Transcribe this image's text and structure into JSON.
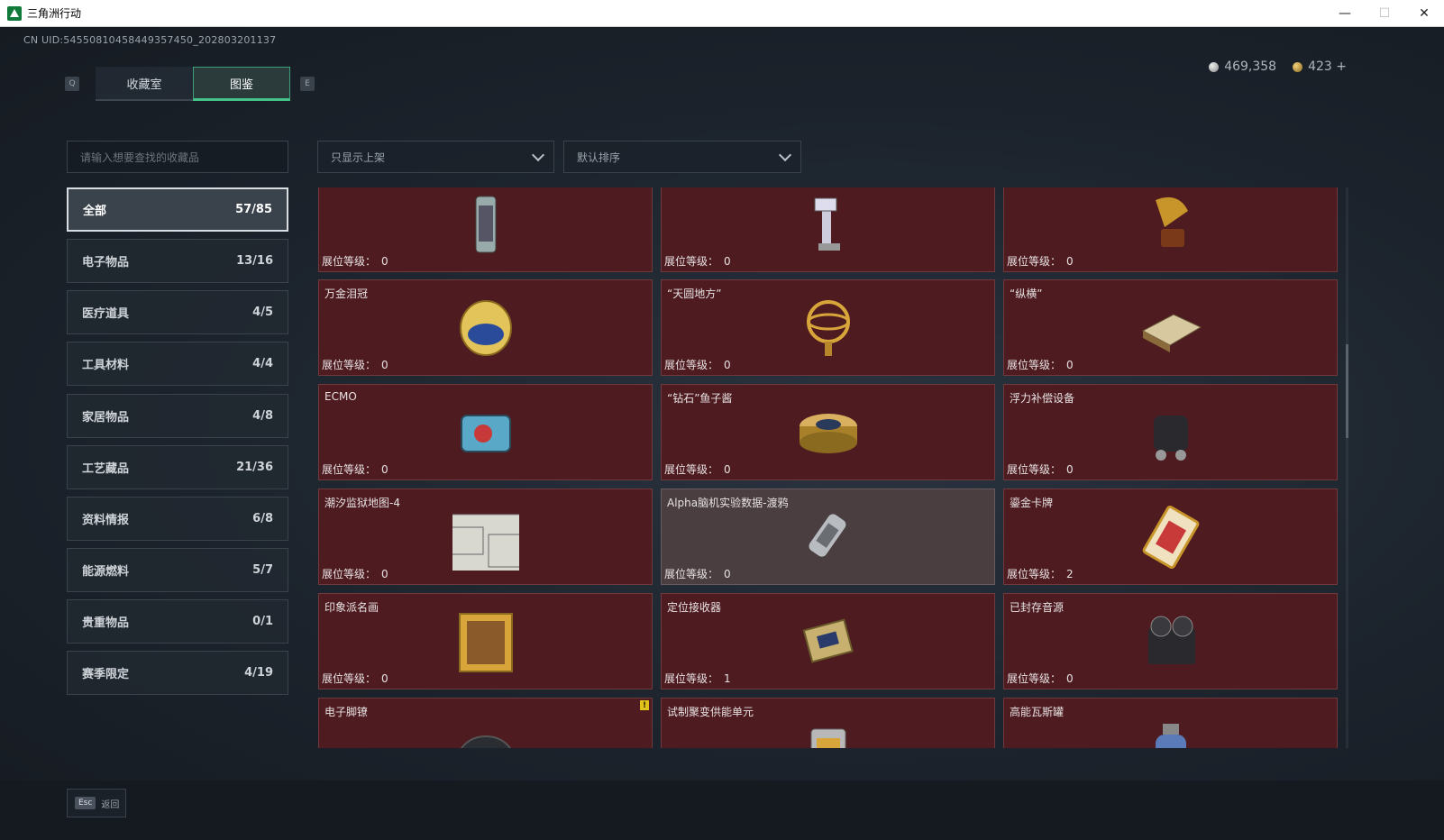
{
  "window": {
    "title": "三角洲行动"
  },
  "uid": "CN UID:54550810458449357450_202803201137",
  "currency": {
    "silver": "469,358",
    "gold": "423 +"
  },
  "tabs": {
    "key_left": "Q",
    "key_right": "E",
    "items": [
      {
        "label": "收藏室",
        "active": false
      },
      {
        "label": "图鉴",
        "active": true
      }
    ]
  },
  "search": {
    "placeholder": "请输入想要查找的收藏品"
  },
  "filters": {
    "display": "只显示上架",
    "sort": "默认排序"
  },
  "categories": [
    {
      "label": "全部",
      "count": "57/85",
      "active": true
    },
    {
      "label": "电子物品",
      "count": "13/16"
    },
    {
      "label": "医疗道具",
      "count": "4/5"
    },
    {
      "label": "工具材料",
      "count": "4/4"
    },
    {
      "label": "家居物品",
      "count": "4/8"
    },
    {
      "label": "工艺藏品",
      "count": "21/36"
    },
    {
      "label": "资料情报",
      "count": "6/8"
    },
    {
      "label": "能源燃料",
      "count": "5/7"
    },
    {
      "label": "贵重物品",
      "count": "0/1"
    },
    {
      "label": "赛季限定",
      "count": "4/19"
    }
  ],
  "level_label": "展位等级：",
  "items": [
    {
      "name": "",
      "level": "0",
      "icon": "reactor-icon"
    },
    {
      "name": "",
      "level": "0",
      "icon": "medical-arm-icon"
    },
    {
      "name": "",
      "level": "0",
      "icon": "gramophone-icon"
    },
    {
      "name": "万金泪冠",
      "level": "0",
      "icon": "jeweled-egg-icon"
    },
    {
      "name": "“天圆地方”",
      "level": "0",
      "icon": "armillary-sphere-icon"
    },
    {
      "name": "“纵横”",
      "level": "0",
      "icon": "chess-box-icon"
    },
    {
      "name": "ECMO",
      "level": "0",
      "icon": "ecmo-machine-icon"
    },
    {
      "name": "“钻石”鱼子酱",
      "level": "0",
      "icon": "caviar-tin-icon"
    },
    {
      "name": "浮力补偿设备",
      "level": "0",
      "icon": "buoyancy-device-icon"
    },
    {
      "name": "潮汐监狱地图-4",
      "level": "0",
      "icon": "prison-map-icon"
    },
    {
      "name": "Alpha脑机实验数据-渡鸦",
      "level": "0",
      "icon": "data-canister-icon",
      "grey": true
    },
    {
      "name": "鎏金卡牌",
      "level": "2",
      "icon": "gilded-card-icon"
    },
    {
      "name": "印象派名画",
      "level": "0",
      "icon": "framed-painting-icon"
    },
    {
      "name": "定位接收器",
      "level": "1",
      "icon": "locator-receiver-icon"
    },
    {
      "name": "已封存音源",
      "level": "0",
      "icon": "reel-recorder-icon"
    },
    {
      "name": "电子脚镣",
      "level": "",
      "icon": "ankle-monitor-icon",
      "badge": "!"
    },
    {
      "name": "试制聚变供能单元",
      "level": "",
      "icon": "fusion-cell-icon"
    },
    {
      "name": "高能瓦斯罐",
      "level": "",
      "icon": "gas-canister-icon"
    }
  ],
  "bottom": {
    "esc_key": "Esc",
    "back_label": "返回"
  },
  "colors": {
    "card_bg": "#4e1b20",
    "accent_green": "#45c38a"
  }
}
